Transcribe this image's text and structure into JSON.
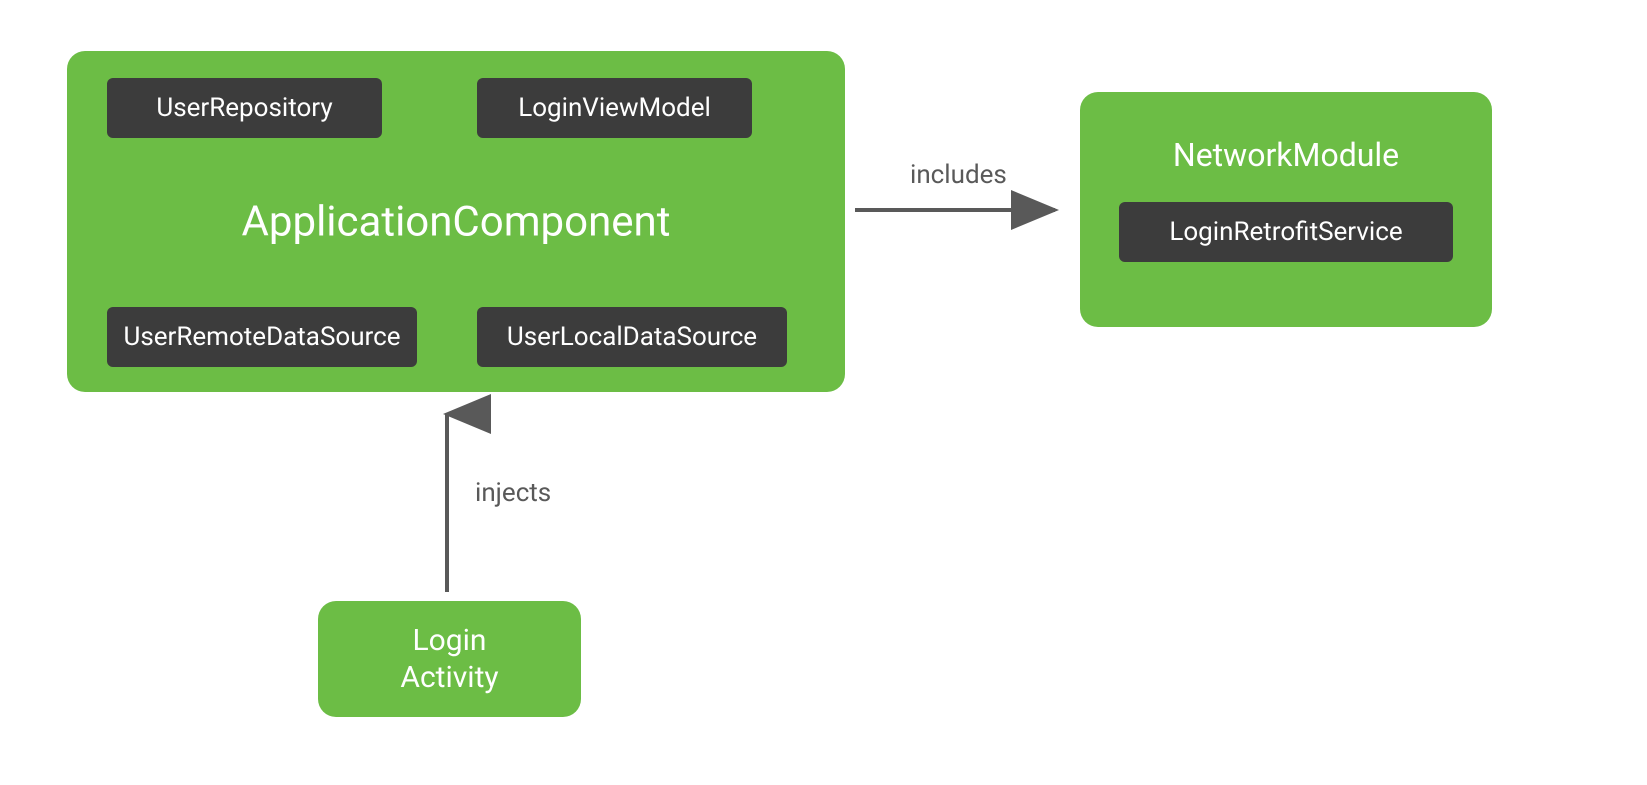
{
  "appComponent": {
    "title": "ApplicationComponent",
    "items": {
      "userRepository": "UserRepository",
      "loginViewModel": "LoginViewModel",
      "userRemoteDataSource": "UserRemoteDataSource",
      "userLocalDataSource": "UserLocalDataSource"
    }
  },
  "networkModule": {
    "title": "NetworkModule",
    "items": {
      "loginRetrofitService": "LoginRetrofitService"
    }
  },
  "loginActivity": {
    "line1": "Login",
    "line2": "Activity"
  },
  "arrows": {
    "includes": "includes",
    "injects": "injects"
  },
  "colors": {
    "green": "#6cbd45",
    "darkBox": "#3c3c3c",
    "arrow": "#595959"
  }
}
